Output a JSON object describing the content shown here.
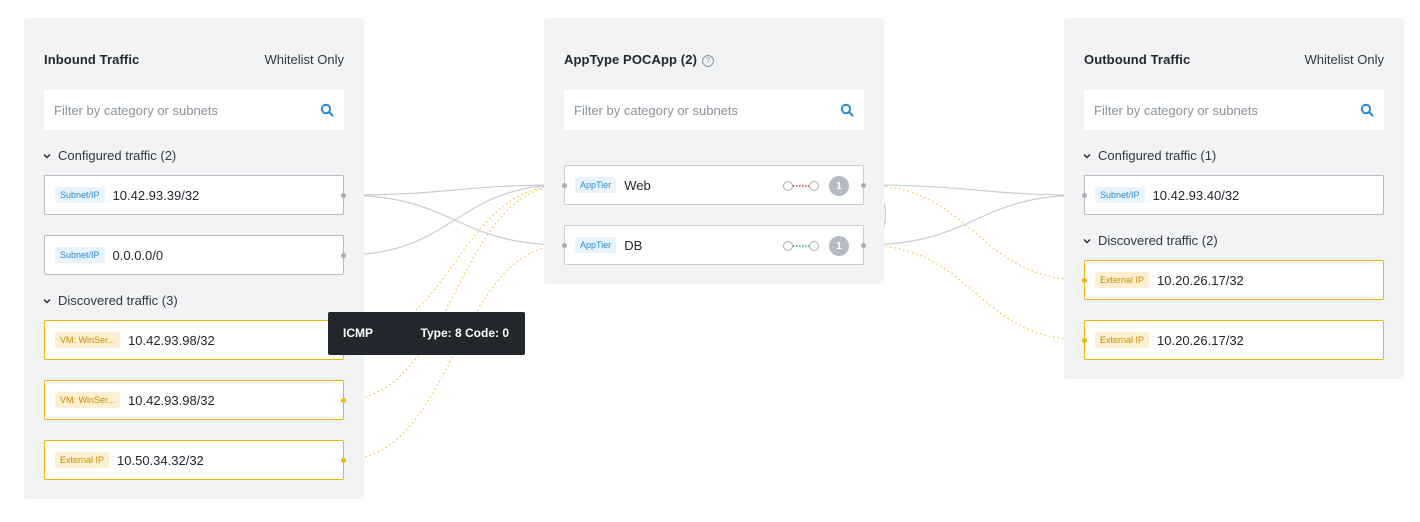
{
  "inbound": {
    "title": "Inbound Traffic",
    "mode": "Whitelist Only",
    "search_placeholder": "Filter by category or subnets",
    "configured_label": "Configured traffic (2)",
    "configured": [
      {
        "tag": "Subnet/IP",
        "value": "10.42.93.39/32"
      },
      {
        "tag": "Subnet/IP",
        "value": "0.0.0.0/0"
      }
    ],
    "discovered_label": "Discovered traffic (3)",
    "discovered": [
      {
        "tag": "VM: WinSer...",
        "value": "10.42.93.98/32"
      },
      {
        "tag": "VM: WinSer...",
        "value": "10.42.93.98/32"
      },
      {
        "tag": "External IP",
        "value": "10.50.34.32/32"
      }
    ]
  },
  "app": {
    "title": "AppType POCApp (2)",
    "help": "?",
    "search_placeholder": "Filter by category or subnets",
    "tiers": [
      {
        "tag": "AppTier",
        "value": "Web",
        "count": "1",
        "link_color": "#e0443e"
      },
      {
        "tag": "AppTier",
        "value": "DB",
        "count": "1",
        "link_color": "#2bb673"
      }
    ]
  },
  "outbound": {
    "title": "Outbound Traffic",
    "mode": "Whitelist Only",
    "search_placeholder": "Filter by category or subnets",
    "configured_label": "Configured traffic (1)",
    "configured": [
      {
        "tag": "Subnet/IP",
        "value": "10.42.93.40/32"
      }
    ],
    "discovered_label": "Discovered traffic (2)",
    "discovered": [
      {
        "tag": "External IP",
        "value": "10.20.26.17/32"
      },
      {
        "tag": "External IP",
        "value": "10.20.26.17/32"
      }
    ]
  },
  "tooltip": {
    "protocol": "ICMP",
    "detail": "Type: 8 Code: 0"
  },
  "colors": {
    "accent_blue": "#2a8bd2",
    "discovered_yellow": "#f4b400",
    "configured_border": "#b7bcc2",
    "panel_bg": "#f2f3f5"
  }
}
